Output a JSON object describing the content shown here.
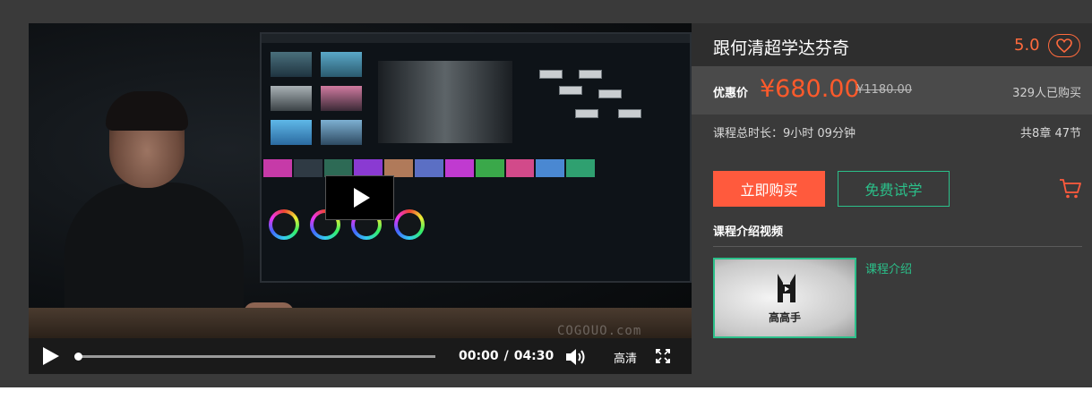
{
  "player": {
    "watermark": "COGOUO.com",
    "current_time": "00:00",
    "time_separator": "/",
    "duration": "04:30",
    "quality_label": "高清",
    "progress": 0
  },
  "course": {
    "title": "跟何清超学达芬奇",
    "rating": "5.0",
    "price_label": "优惠价",
    "price": "¥680.00",
    "original_price": "¥1180.00",
    "buyers": "329人已购买",
    "total_duration": "课程总时长：9小时 09分钟",
    "chapters": "共8章 47节",
    "buy_label": "立即购买",
    "trial_label": "免费试学",
    "intro_section_title": "课程介绍视频",
    "intro_thumb_brand": "高高手",
    "intro_link": "课程介绍"
  },
  "colors": {
    "accent_orange": "#ff5a3d",
    "accent_green": "#2bc08a",
    "panel_bg": "#3a3a3a"
  }
}
